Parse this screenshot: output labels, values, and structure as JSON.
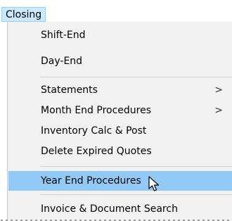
{
  "menubar": {
    "active_menu_label": "Closing"
  },
  "menu": {
    "items": [
      {
        "label": "Shift-End",
        "has_submenu": false
      },
      {
        "label": "Day-End",
        "has_submenu": false
      },
      {
        "label": "Statements",
        "has_submenu": true
      },
      {
        "label": "Month End Procedures",
        "has_submenu": true
      },
      {
        "label": "Inventory Calc & Post",
        "has_submenu": false
      },
      {
        "label": "Delete Expired Quotes",
        "has_submenu": false
      },
      {
        "label": "Year End Procedures",
        "has_submenu": false,
        "highlighted": true
      },
      {
        "label": "Invoice & Document Search",
        "has_submenu": false
      }
    ],
    "submenu_arrow_glyph": ">"
  },
  "cursor": {
    "icon": "arrow-pointer-icon"
  },
  "colors": {
    "menu_background": "#f2f2f2",
    "highlight": "#91c9f7",
    "menubar_active": "#cce8ff"
  }
}
